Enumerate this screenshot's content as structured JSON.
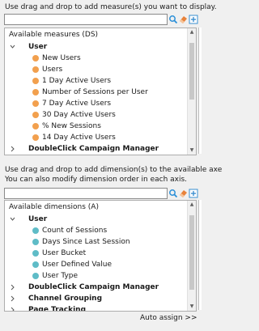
{
  "measures": {
    "instruction": "Use drag and drop to add measure(s) you want to display.",
    "panel_title": "Available measures (DS)",
    "group": "User",
    "items": [
      "New Users",
      "Users",
      "1 Day Active Users",
      "Number of Sessions per User",
      "7 Day Active Users",
      "30 Day Active Users",
      "% New Sessions",
      "14 Day Active Users"
    ],
    "collapsed_groups": [
      "DoubleClick Campaign Manager"
    ]
  },
  "dimensions": {
    "instruction_line1": "Use drag and drop to add dimension(s) to the available axe",
    "instruction_line2": "You can also modify dimension order in each axis.",
    "panel_title": "Available dimensions (A)",
    "group": "User",
    "items": [
      "Count of Sessions",
      "Days Since Last Session",
      "User Bucket",
      "User Defined Value",
      "User Type"
    ],
    "collapsed_groups": [
      "DoubleClick Campaign Manager",
      "Channel Grouping"
    ],
    "partial_group": "Page Tracking"
  },
  "auto_assign": "Auto assign >>",
  "colors": {
    "measure_dot": "#f2a04e",
    "dimension_dot": "#5fbcc7",
    "search_icon": "#2a8fd8",
    "eraser_icon": "#e8823a",
    "add_icon": "#3a8fd0"
  },
  "icons": [
    "search-icon",
    "eraser-icon",
    "add-icon",
    "chevron-down-icon",
    "chevron-right-icon"
  ]
}
